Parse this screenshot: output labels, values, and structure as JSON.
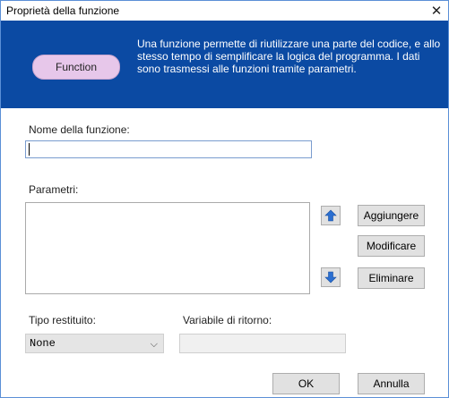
{
  "window": {
    "title": "Proprietà della funzione",
    "close_glyph": "✕"
  },
  "banner": {
    "badge": "Function",
    "description": "Una funzione permette di riutilizzare una parte del codice, e allo stesso tempo di semplificare la logica del programma. I dati sono trasmessi alle funzioni tramite parametri."
  },
  "form": {
    "name_label": "Nome della funzione:",
    "name_value": "",
    "params_label": "Parametri:",
    "params_items": [],
    "return_type_label": "Tipo restituito:",
    "return_type_value": "None",
    "return_var_label": "Variabile di ritorno:",
    "return_var_value": ""
  },
  "buttons": {
    "add": "Aggiungere",
    "modify": "Modificare",
    "delete": "Eliminare",
    "ok": "OK",
    "cancel": "Annulla"
  },
  "icons": {
    "move_up": "arrow-up-icon",
    "move_down": "arrow-down-icon",
    "dropdown": "chevron-down-icon"
  },
  "colors": {
    "banner_bg": "#0b4aa3",
    "badge_bg": "#e7c7ea",
    "arrow_blue": "#2b6fd1"
  }
}
